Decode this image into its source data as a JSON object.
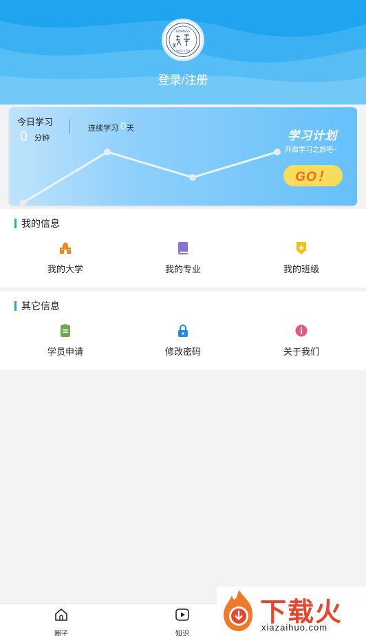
{
  "header": {
    "login_label": "登录/注册",
    "logo_text": "BUSINESS SCHOOL",
    "logo_since": "SINCE 2019",
    "bg_color": "#21a4f0"
  },
  "study_card": {
    "today_label": "今日学习",
    "today_value": "0",
    "today_unit": "分钟",
    "streak_label": "连续学习",
    "streak_value": "0",
    "streak_unit": "天",
    "plan_title": "学习计划",
    "plan_subtitle": "开启学习之旅吧~",
    "go_label": "GO！"
  },
  "my_info": {
    "title": "我的信息",
    "items": [
      {
        "label": "我的大学",
        "icon": "university-icon",
        "color": "#f5821f"
      },
      {
        "label": "我的专业",
        "icon": "book-icon",
        "color": "#8a6fd6"
      },
      {
        "label": "我的班级",
        "icon": "class-badge-icon",
        "color": "#f2c21b"
      }
    ]
  },
  "other_info": {
    "title": "其它信息",
    "items": [
      {
        "label": "学员申请",
        "icon": "clipboard-icon",
        "color": "#6ba84f"
      },
      {
        "label": "修改密码",
        "icon": "lock-icon",
        "color": "#1e8de0"
      },
      {
        "label": "关于我们",
        "icon": "info-icon",
        "color": "#e8587a"
      }
    ]
  },
  "bottom_nav": [
    {
      "label": "圈子",
      "icon": "home-icon"
    },
    {
      "label": "知识",
      "icon": "play-icon"
    }
  ],
  "watermark": {
    "text": "下载火",
    "url": "xiazaihuo.com"
  },
  "colors": {
    "accent": "#21a4f0",
    "go_button": "#f8dd5a",
    "go_text": "#f4681e"
  }
}
